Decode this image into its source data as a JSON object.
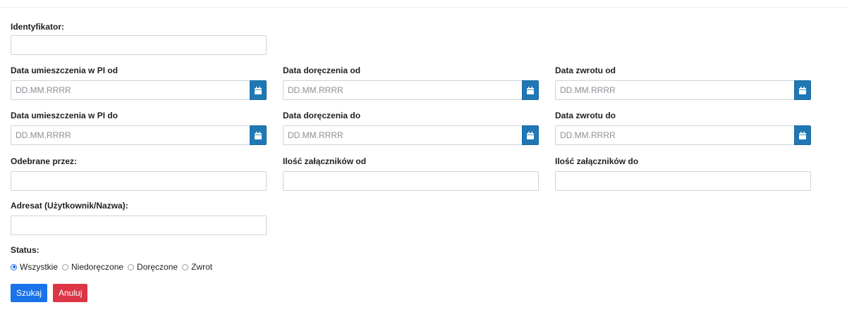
{
  "form": {
    "identyfikator": {
      "label": "Identyfikator:",
      "value": ""
    },
    "date_fields": [
      {
        "label": "Data umieszczenia w PI od",
        "placeholder": "DD.MM.RRRR",
        "icon": "calendar-icon"
      },
      {
        "label": "Data doręczenia od",
        "placeholder": "DD.MM.RRRR",
        "icon": "calendar-icon"
      },
      {
        "label": "Data zwrotu od",
        "placeholder": "DD.MM.RRRR",
        "icon": "calendar-icon"
      },
      {
        "label": "Data umieszczenia w PI do",
        "placeholder": "DD.MM.RRRR",
        "icon": "calendar-icon"
      },
      {
        "label": "Data doręczenia do",
        "placeholder": "DD.MM.RRRR",
        "icon": "calendar-icon"
      },
      {
        "label": "Data zwrotu do",
        "placeholder": "DD.MM.RRRR",
        "icon": "calendar-icon"
      }
    ],
    "odebrane_przez": {
      "label": "Odebrane przez:",
      "value": ""
    },
    "ilosc_od": {
      "label": "Ilość załączników od",
      "value": ""
    },
    "ilosc_do": {
      "label": "Ilość załączników do",
      "value": ""
    },
    "adresat": {
      "label": "Adresat (Użytkownik/Nazwa):",
      "value": ""
    },
    "status": {
      "label": "Status:",
      "selected": "Wszystkie",
      "options": [
        "Wszystkie",
        "Niedoręczone",
        "Doręczone",
        "Zwrot"
      ]
    }
  },
  "actions": {
    "search_label": "Szukaj",
    "cancel_label": "Anuluj"
  },
  "colors": {
    "primary": "#1a73e8",
    "danger": "#dc3545",
    "calendar_button": "#1f78b4"
  }
}
